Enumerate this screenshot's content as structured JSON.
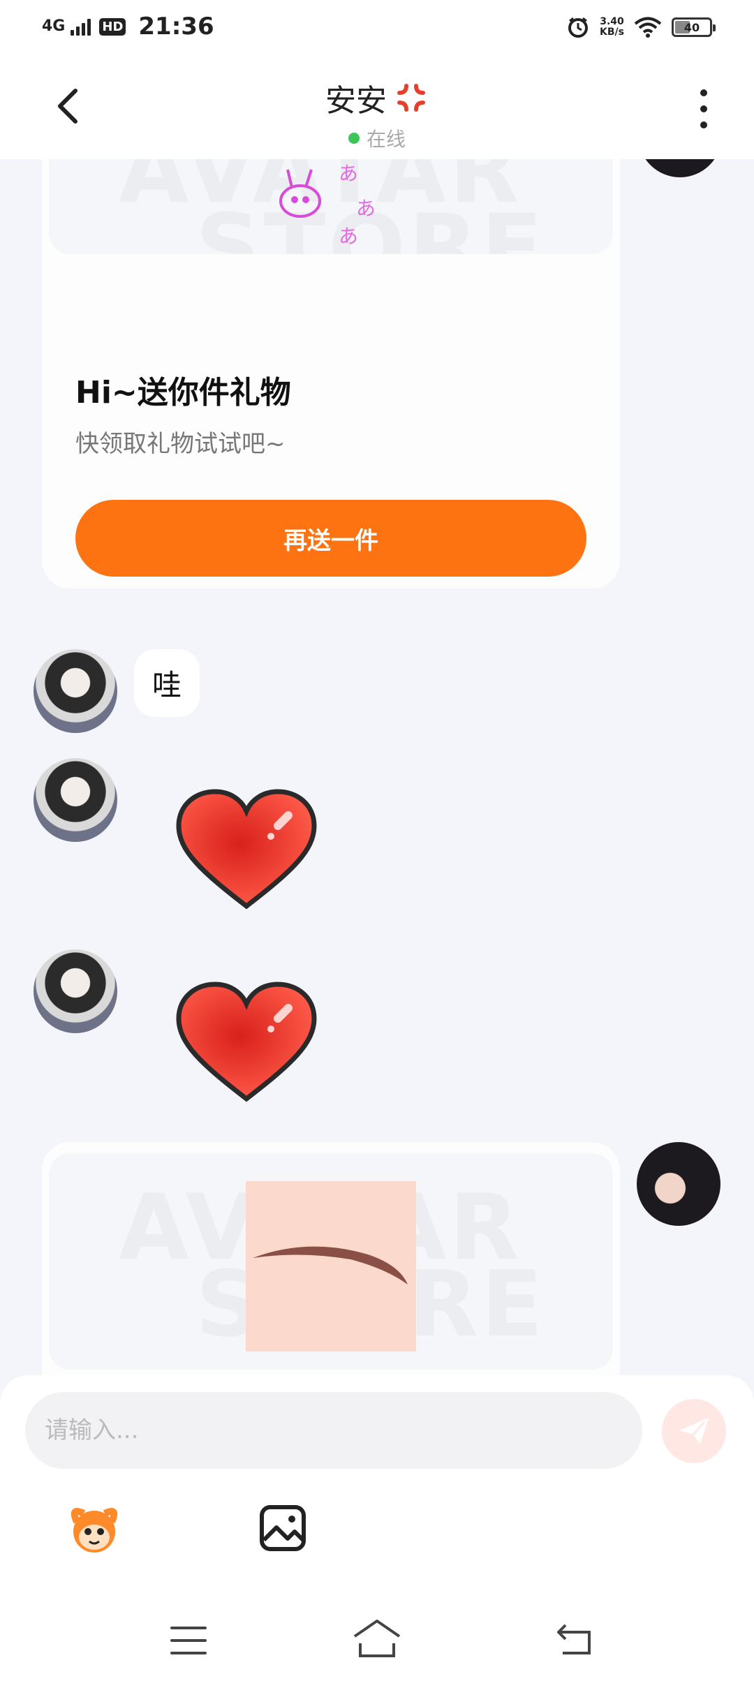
{
  "status_bar": {
    "network": "4G",
    "hd": "HD",
    "time": "21:36",
    "speed_value": "3.40",
    "speed_unit": "KB/s",
    "battery": "40"
  },
  "header": {
    "title": "安安",
    "online_status": "在线"
  },
  "chat": {
    "gift_card_1": {
      "title": "Hi~送你件礼物",
      "subtitle": "快领取礼物试试吧~",
      "button": "再送一件",
      "watermark_top": "AVATAR",
      "watermark_bottom": "STORE"
    },
    "message_wa": "哇",
    "gift_card_2": {
      "watermark_top": "AVATAR",
      "watermark_bottom": "STORE"
    }
  },
  "input": {
    "placeholder": "请输入..."
  },
  "colors": {
    "accent": "#fd7312",
    "online": "#3cc65a"
  }
}
